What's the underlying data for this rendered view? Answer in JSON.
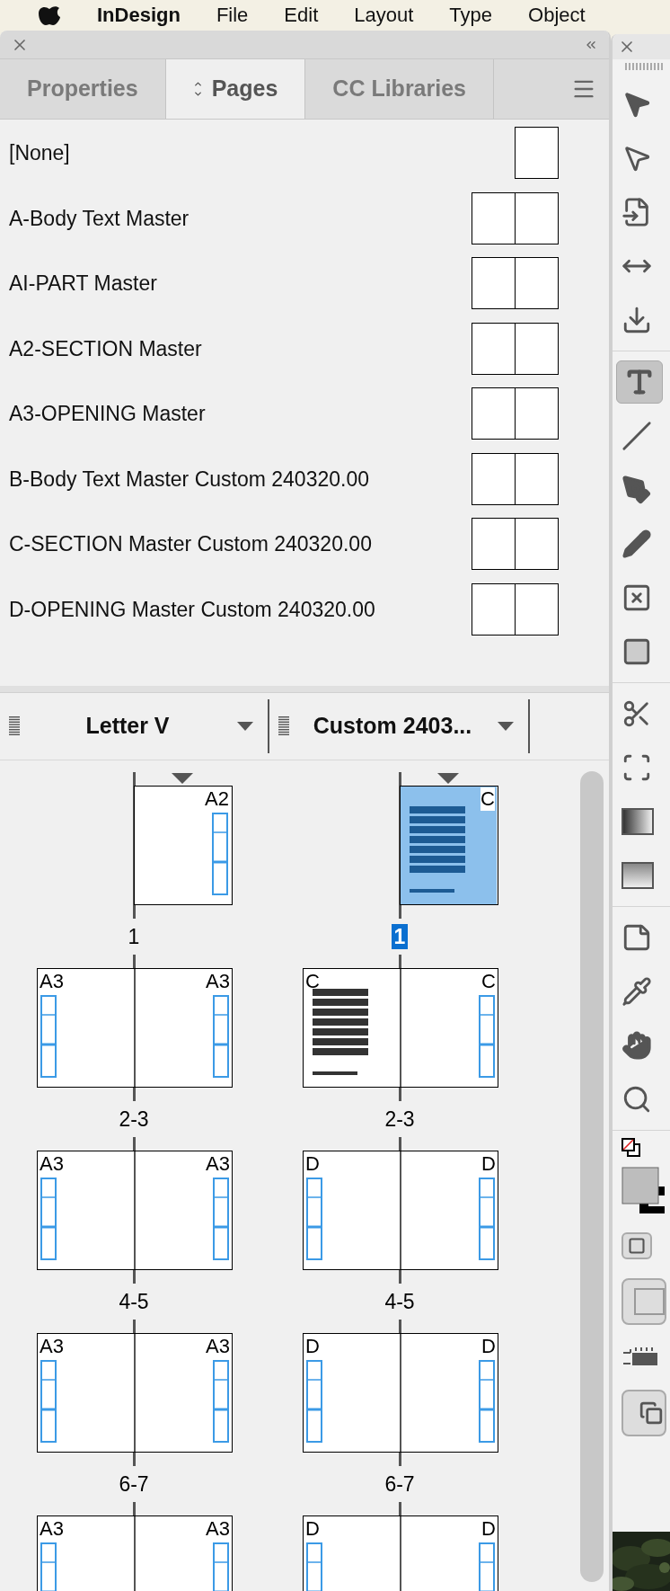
{
  "menu_bar": {
    "app_name": "InDesign",
    "menus": [
      "File",
      "Edit",
      "Layout",
      "Type",
      "Object"
    ]
  },
  "panel": {
    "tabs": [
      {
        "label": "Properties",
        "selected": false
      },
      {
        "label": "Pages",
        "selected": true
      },
      {
        "label": "CC Libraries",
        "selected": false
      }
    ],
    "masters": [
      {
        "name": "[None]",
        "kind": "single"
      },
      {
        "name": "A-Body Text Master",
        "kind": "spread"
      },
      {
        "name": "AI-PART Master",
        "kind": "spread"
      },
      {
        "name": "A2-SECTION Master",
        "kind": "spread"
      },
      {
        "name": "A3-OPENING Master",
        "kind": "spread"
      },
      {
        "name": "B-Body Text Master Custom 240320.00",
        "kind": "spread"
      },
      {
        "name": "C-SECTION Master Custom 240320.00",
        "kind": "spread"
      },
      {
        "name": "D-OPENING Master Custom 240320.00",
        "kind": "spread"
      }
    ],
    "page_columns": [
      {
        "label": "Letter V"
      },
      {
        "label": "Custom 2403..."
      }
    ],
    "page_rows": [
      {
        "cells": [
          {
            "label": "1",
            "selected": false,
            "section_start": true,
            "pages": [
              {
                "master": "A2",
                "kind": "frames"
              }
            ]
          },
          {
            "label": "1",
            "selected": true,
            "section_start": true,
            "pages": [
              {
                "master": "C",
                "kind": "text"
              }
            ]
          }
        ]
      },
      {
        "cells": [
          {
            "label": "2-3",
            "selected": false,
            "section_start": false,
            "pages": [
              {
                "master": "A3",
                "kind": "frames"
              },
              {
                "master": "A3",
                "kind": "frames"
              }
            ]
          },
          {
            "label": "2-3",
            "selected": false,
            "section_start": false,
            "pages": [
              {
                "master": "C",
                "kind": "text"
              },
              {
                "master": "C",
                "kind": "frames"
              }
            ]
          }
        ]
      },
      {
        "cells": [
          {
            "label": "4-5",
            "selected": false,
            "section_start": false,
            "pages": [
              {
                "master": "A3",
                "kind": "frames"
              },
              {
                "master": "A3",
                "kind": "frames"
              }
            ]
          },
          {
            "label": "4-5",
            "selected": false,
            "section_start": false,
            "pages": [
              {
                "master": "D",
                "kind": "frames"
              },
              {
                "master": "D",
                "kind": "frames"
              }
            ]
          }
        ]
      },
      {
        "cells": [
          {
            "label": "6-7",
            "selected": false,
            "section_start": false,
            "pages": [
              {
                "master": "A3",
                "kind": "frames"
              },
              {
                "master": "A3",
                "kind": "frames"
              }
            ]
          },
          {
            "label": "6-7",
            "selected": false,
            "section_start": false,
            "pages": [
              {
                "master": "D",
                "kind": "frames"
              },
              {
                "master": "D",
                "kind": "frames"
              }
            ]
          }
        ]
      },
      {
        "cells": [
          {
            "selected": false,
            "section_start": false,
            "pages": [
              {
                "master": "A3",
                "kind": "frames"
              },
              {
                "master": "A3",
                "kind": "frames"
              }
            ]
          },
          {
            "selected": false,
            "section_start": false,
            "pages": [
              {
                "master": "D",
                "kind": "frames"
              },
              {
                "master": "D",
                "kind": "frames"
              }
            ]
          }
        ]
      }
    ]
  },
  "toolbar": {
    "groups": [
      {
        "tools": [
          {
            "kind": "selection",
            "selected": false
          },
          {
            "kind": "direct_selection",
            "selected": false
          },
          {
            "kind": "page",
            "selected": false
          },
          {
            "kind": "gap",
            "selected": false
          },
          {
            "kind": "collector",
            "selected": false
          }
        ]
      },
      {
        "tools": [
          {
            "kind": "type",
            "selected": true
          },
          {
            "kind": "line",
            "selected": false
          },
          {
            "kind": "pen",
            "selected": false
          },
          {
            "kind": "pencil",
            "selected": false
          },
          {
            "kind": "frame",
            "selected": false
          },
          {
            "kind": "rectangle",
            "selected": false
          }
        ]
      },
      {
        "tools": [
          {
            "kind": "scissors",
            "selected": false
          },
          {
            "kind": "free_transform",
            "selected": false
          },
          {
            "kind": "gradient",
            "selected": false
          },
          {
            "kind": "feather",
            "selected": false
          }
        ]
      },
      {
        "tools": [
          {
            "kind": "note",
            "selected": false
          },
          {
            "kind": "eyedropper",
            "selected": false
          },
          {
            "kind": "hand",
            "selected": false
          },
          {
            "kind": "zoom",
            "selected": false
          }
        ]
      },
      {
        "tools": [
          {
            "kind": "default_colors",
            "selected": false
          },
          {
            "kind": "fill_stroke",
            "selected": false
          },
          {
            "kind": "format_container",
            "selected": false
          },
          {
            "kind": "view_normal",
            "selected": false
          },
          {
            "kind": "preview",
            "selected": false
          },
          {
            "kind": "screen_mode",
            "selected": false
          }
        ]
      }
    ]
  }
}
